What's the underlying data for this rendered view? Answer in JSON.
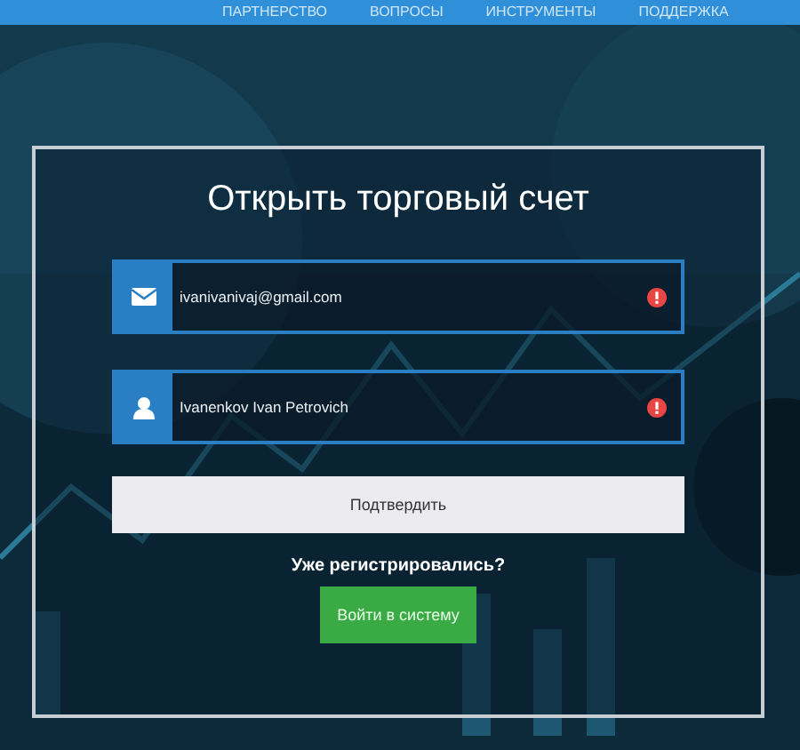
{
  "nav": {
    "items": [
      "ПАРТНЕРСТВО",
      "ВОПРОСЫ",
      "ИНСТРУМЕНТЫ",
      "ПОДДЕРЖКА"
    ]
  },
  "form": {
    "title": "Открыть торговый счет",
    "fields": [
      {
        "kind": "email",
        "value": "ivanivanivaj@gmail.com",
        "error": true
      },
      {
        "kind": "user",
        "value": "Ivanenkov Ivan Petrovich",
        "error": true
      }
    ],
    "submit": "Подтвердить",
    "question": "Уже регистрировались?",
    "login": "Войти в систему"
  }
}
